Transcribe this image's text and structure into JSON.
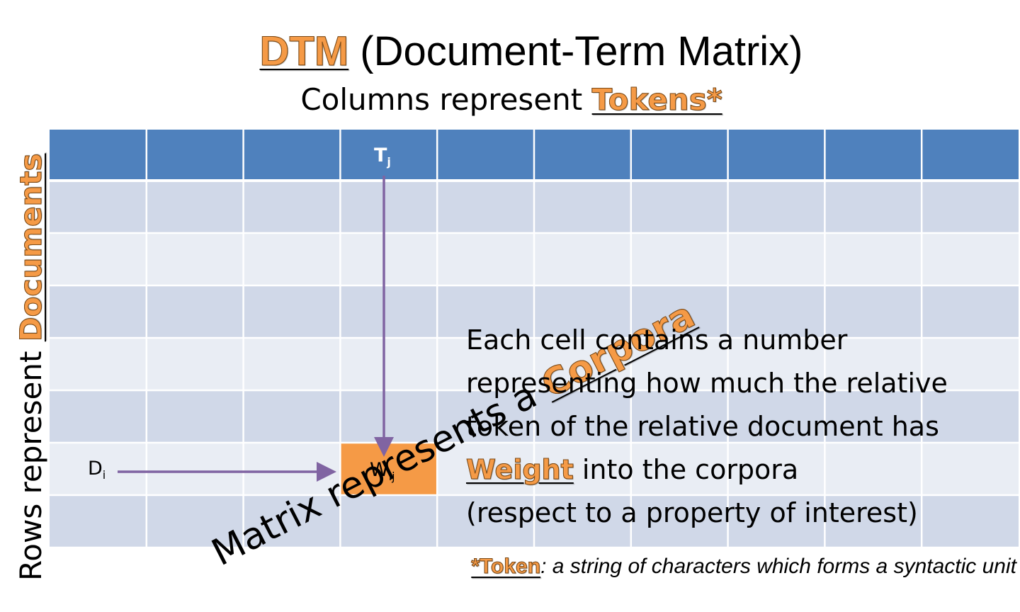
{
  "title": {
    "highlight": "DTM",
    "rest": "(Document-Term Matrix)"
  },
  "subtitle": {
    "prefix": "Columns represent ",
    "highlight": "Tokens*"
  },
  "rows_label": {
    "prefix": "Rows represent ",
    "highlight": "Documents"
  },
  "diagonal_label": {
    "prefix": "Matrix represents a ",
    "highlight": "Corpora"
  },
  "matrix": {
    "columns": 10,
    "body_rows": 7
  },
  "column_marker": {
    "letter": "T",
    "sub": "j"
  },
  "row_marker": {
    "letter": "D",
    "sub": "i"
  },
  "cell_marker": {
    "letter": "W",
    "sub": "ij"
  },
  "description": {
    "line1": "Each cell contains a number",
    "line2": "representing how much the relative",
    "line3": "token of the relative document has",
    "line4_highlight": "Weight",
    "line4_rest": " into the corpora",
    "line5": "(respect to a property of interest)"
  },
  "footnote": {
    "highlight": "*Token",
    "rest": ": a string of characters which forms a syntactic unit"
  },
  "colors": {
    "header_blue": "#4f81bd",
    "band_dark": "#d0d8e8",
    "band_light": "#e9edf4",
    "grid_line": "#ffffff",
    "highlight_orange": "#f59a46",
    "arrow_purple": "#8064a2"
  }
}
